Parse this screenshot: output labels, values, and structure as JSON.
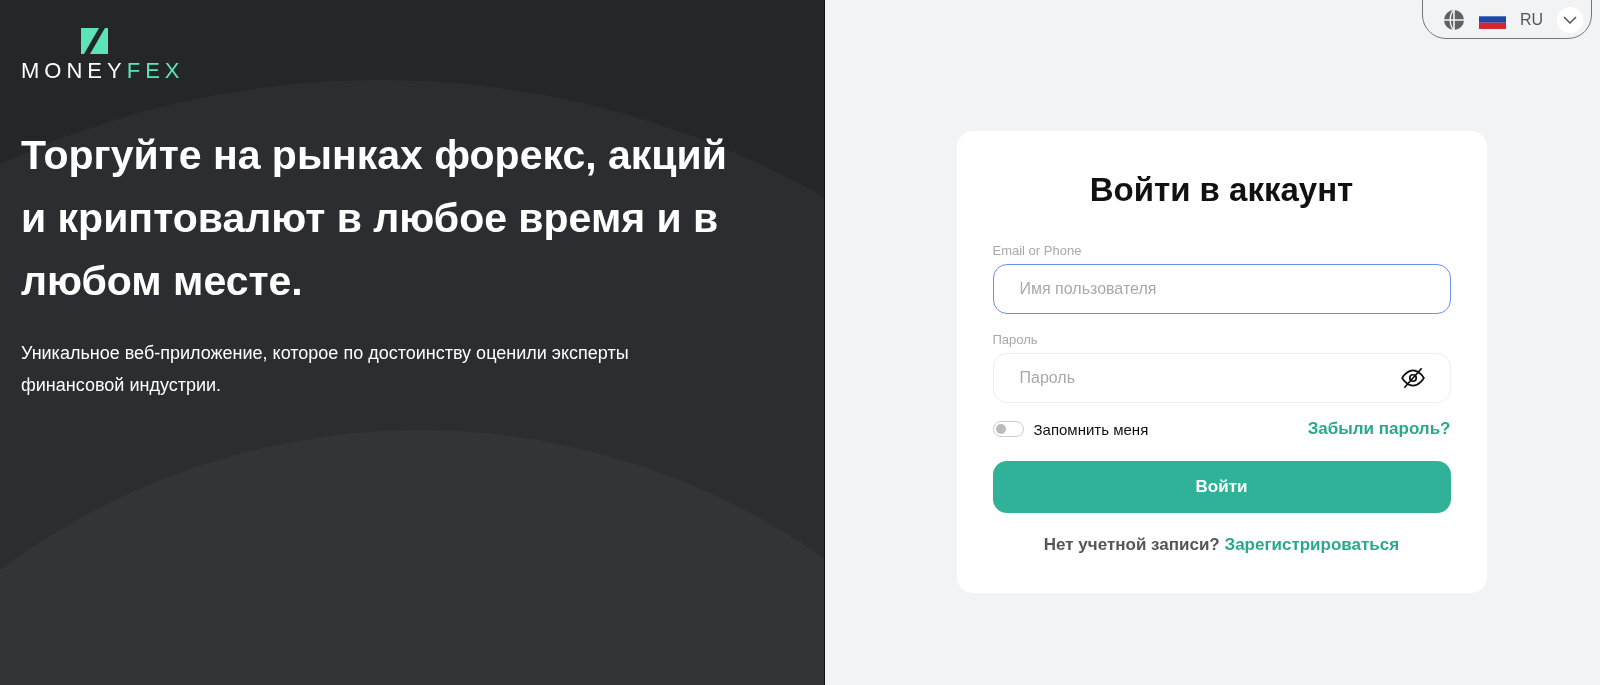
{
  "logo": {
    "text_1": "MONEY",
    "text_2": "FEX"
  },
  "hero": {
    "headline": "Торгуйте на рынках форекс, акций и криптовалют в любое время и в любом месте.",
    "subtitle": "Уникальное веб-приложение, которое по достоинству оценили эксперты финансовой индустрии."
  },
  "language": {
    "code": "RU"
  },
  "login": {
    "title": "Войти в аккаунт",
    "fields": [
      {
        "kind": "text",
        "label": "Email or Phone",
        "placeholder": "Имя пользователя",
        "focused": true
      },
      {
        "kind": "password",
        "label": "Пароль",
        "placeholder": "Пароль",
        "focused": false
      }
    ],
    "remember": {
      "label": "Запомнить меня",
      "on": false
    },
    "forgot": "Забыли пароль?",
    "submit": "Войти",
    "signup_prompt": "Нет учетной записи?",
    "signup_link": "Зарегистрироваться"
  }
}
